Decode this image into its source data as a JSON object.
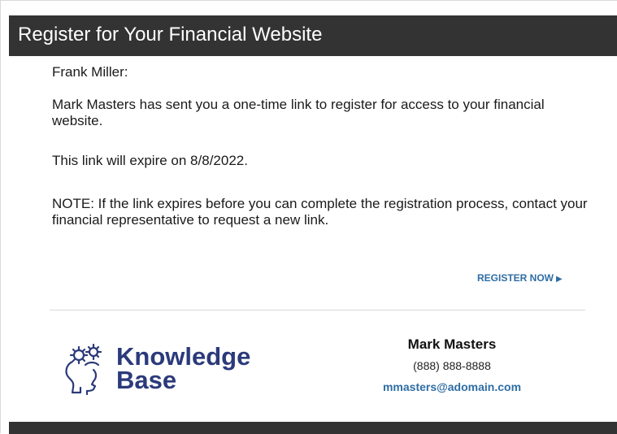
{
  "header": {
    "title": "Register for Your Financial Website"
  },
  "message": {
    "greeting": "Frank Miller:",
    "body": "Mark Masters has sent you a one-time link to register for access to your financial website.",
    "expiry": "This link will expire on 8/8/2022.",
    "note": "NOTE: If the link expires before you can complete the registration process, contact your financial representative to request a new link."
  },
  "actions": {
    "register_label": "REGISTER NOW",
    "register_icon": "play-triangle-icon"
  },
  "logo": {
    "line1": "Knowledge",
    "line2": "Base",
    "icon": "head-with-gears-icon"
  },
  "contact": {
    "name": "Mark Masters",
    "phone": "(888) 888-8888",
    "email": "mmasters@adomain.com"
  },
  "colors": {
    "header_bg": "#333333",
    "link": "#2e6da4",
    "logo": "#2b3a7a"
  }
}
